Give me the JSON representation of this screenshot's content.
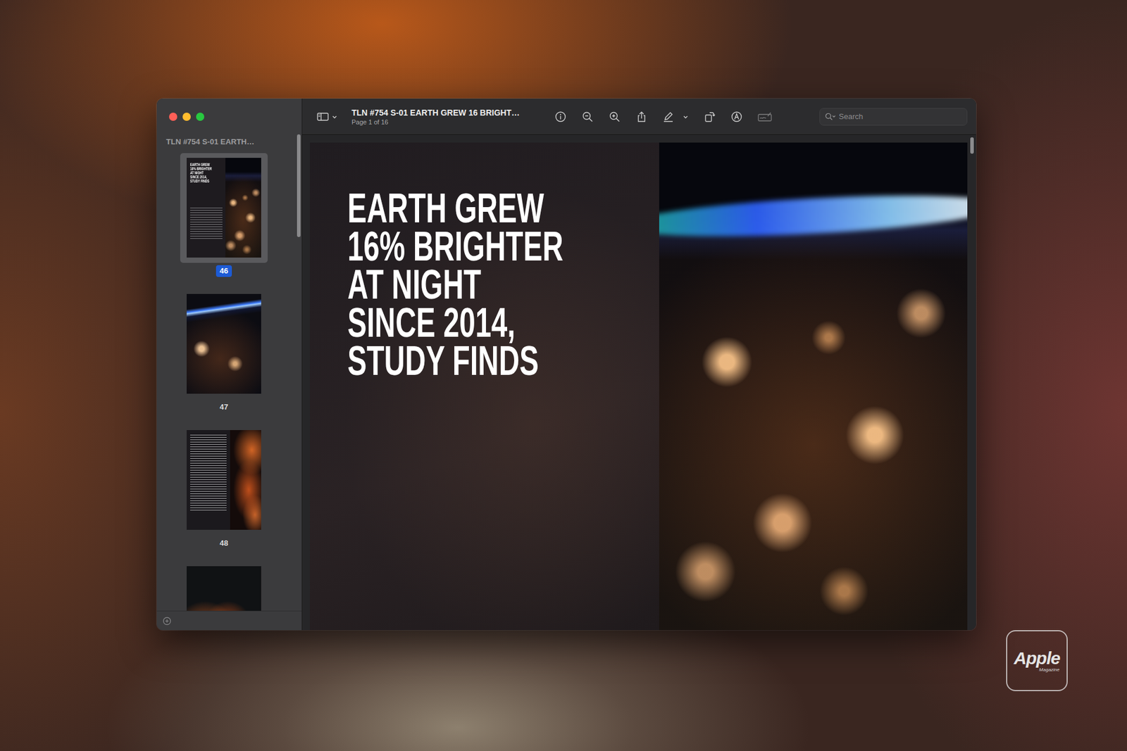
{
  "window": {
    "title": "TLN #754 S-01 EARTH GREW 16 BRIGHT…",
    "subtitle": "Page 1 of 16"
  },
  "search": {
    "placeholder": "Search"
  },
  "sidebar": {
    "title": "TLN #754 S-01 EARTH…",
    "pages": [
      {
        "label": "46",
        "selected": true,
        "kind": "cover"
      },
      {
        "label": "47",
        "selected": false,
        "kind": "photo"
      },
      {
        "label": "48",
        "selected": false,
        "kind": "text"
      },
      {
        "selected": false,
        "kind": "fire"
      }
    ]
  },
  "page": {
    "headline": [
      "EARTH GREW",
      "16% BRIGHTER",
      "AT NIGHT",
      "SINCE 2014,",
      "STUDY FINDS"
    ]
  },
  "logo": {
    "name": "Apple",
    "sub": "Magazine"
  }
}
